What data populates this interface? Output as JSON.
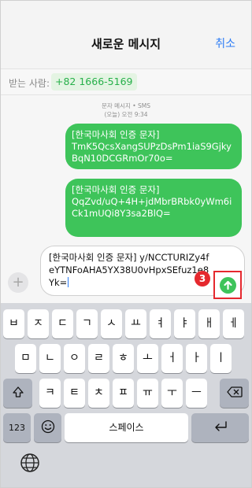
{
  "header": {
    "title": "새로운 메시지",
    "cancel_label": "취소",
    "to_label": "받는 사람:",
    "recipient": "+82 1666-5169"
  },
  "thread": {
    "meta_line1": "문자 메시지 • SMS",
    "meta_line2": "(오늘) 오전 9:34",
    "messages": [
      {
        "line1": "[한국마사회 인증 문자]",
        "line2": "TmK5QcsXangSUPzDsPm1iaS9GjkyBqN10DCGRmOr70o="
      },
      {
        "line1": "[한국마사회 인증 문자]",
        "line2": "QqZvd/uQ+4H+jdMbrBRbk0yWm6iCk1mUQi8Y3sa2BlQ="
      }
    ]
  },
  "compose": {
    "text": "[한국마사회 인증 문자] y/NCCTURIZy4feYTNFoAHA5YX38U0vHpxSEfuz1e8Yk=",
    "annotation_number": "3",
    "accent_color": "#3ec45a",
    "highlight_color": "#e5282e"
  },
  "keyboard": {
    "row1": [
      "ㅂ",
      "ㅈ",
      "ㄷ",
      "ㄱ",
      "ㅅ",
      "ㅛ",
      "ㅕ",
      "ㅑ",
      "ㅐ",
      "ㅔ"
    ],
    "row2": [
      "ㅁ",
      "ㄴ",
      "ㅇ",
      "ㄹ",
      "ㅎ",
      "ㅗ",
      "ㅓ",
      "ㅏ",
      "ㅣ"
    ],
    "row3": [
      "ㅋ",
      "ㅌ",
      "ㅊ",
      "ㅍ",
      "ㅠ",
      "ㅜ",
      "ㅡ"
    ],
    "numbers_label": "123",
    "space_label": "스페이스"
  }
}
